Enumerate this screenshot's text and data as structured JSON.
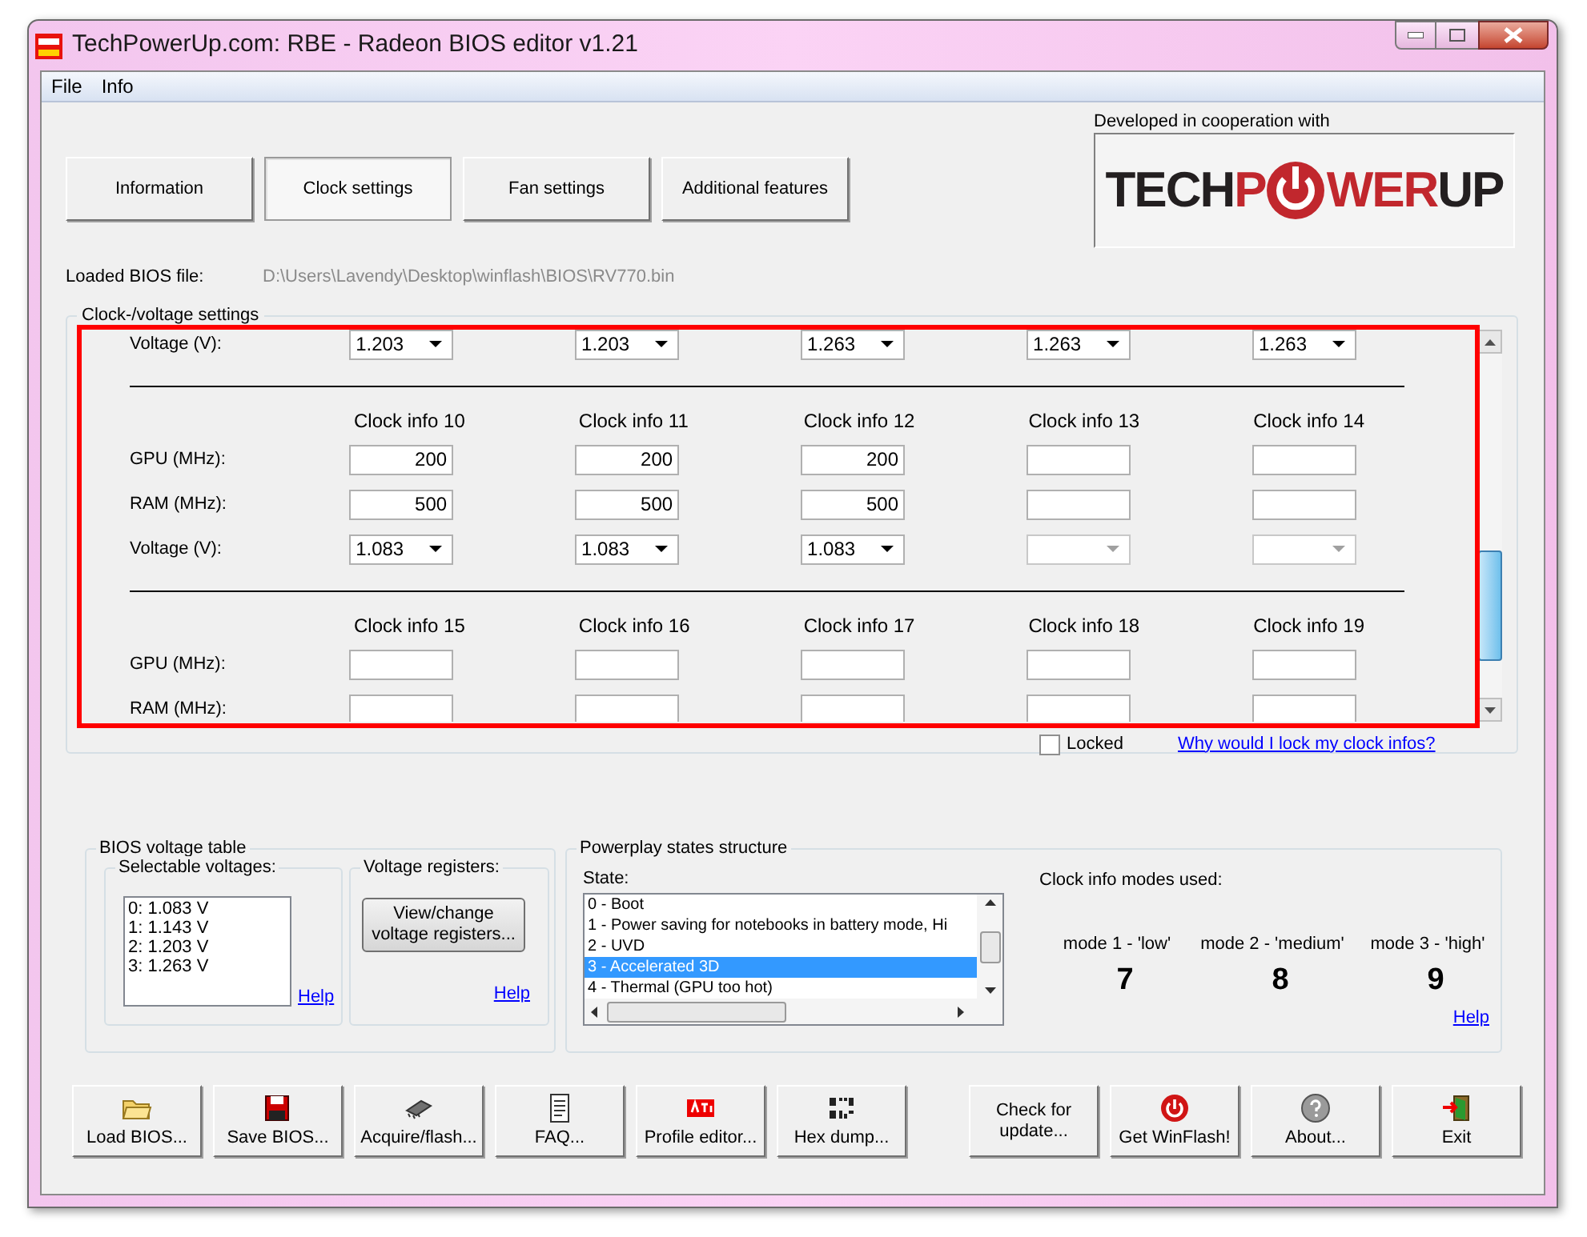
{
  "window": {
    "title": "TechPowerUp.com: RBE - Radeon BIOS editor v1.21"
  },
  "menu": [
    "File",
    "Info"
  ],
  "tabs": [
    {
      "label": "Information",
      "selected": false
    },
    {
      "label": "Clock settings",
      "selected": true
    },
    {
      "label": "Fan settings",
      "selected": false
    },
    {
      "label": "Additional features",
      "selected": false
    }
  ],
  "cooperation": {
    "caption": "Developed in cooperation with",
    "logo": [
      {
        "kind": "text",
        "text": "TECH",
        "color": "#231f20"
      },
      {
        "kind": "text",
        "text": "P",
        "color": "#c1272d"
      },
      {
        "kind": "power",
        "color": "#c1272d"
      },
      {
        "kind": "text",
        "text": "WER",
        "color": "#c1272d"
      },
      {
        "kind": "text",
        "text": "UP",
        "color": "#231f20"
      }
    ]
  },
  "loaded_file": {
    "label": "Loaded BIOS file:",
    "path": "D:\\Users\\Lavendy\\Desktop\\winflash\\BIOS\\RV770.bin"
  },
  "clock_voltage": {
    "title": "Clock-/voltage settings",
    "sections": [
      {
        "rows": [
          {
            "label": "Voltage (V):",
            "kind": "dropdown",
            "cells": [
              {
                "value": "1.203",
                "disabled": false
              },
              {
                "value": "1.203",
                "disabled": false
              },
              {
                "value": "1.263",
                "disabled": false
              },
              {
                "value": "1.263",
                "disabled": false
              },
              {
                "value": "1.263",
                "disabled": false
              }
            ]
          }
        ]
      },
      {
        "headers": [
          "Clock info 10",
          "Clock info 11",
          "Clock info 12",
          "Clock info 13",
          "Clock info 14"
        ],
        "rows": [
          {
            "label": "GPU (MHz):",
            "kind": "text",
            "cells": [
              {
                "value": "200"
              },
              {
                "value": "200"
              },
              {
                "value": "200"
              },
              {},
              {}
            ]
          },
          {
            "label": "RAM (MHz):",
            "kind": "text",
            "cells": [
              {
                "value": "500"
              },
              {
                "value": "500"
              },
              {
                "value": "500"
              },
              {},
              {}
            ]
          },
          {
            "label": "Voltage (V):",
            "kind": "dropdown",
            "cells": [
              {
                "value": "1.083",
                "disabled": false
              },
              {
                "value": "1.083",
                "disabled": false
              },
              {
                "value": "1.083",
                "disabled": false
              },
              {
                "disabled": true
              },
              {
                "disabled": true
              }
            ]
          }
        ]
      },
      {
        "headers": [
          "Clock info 15",
          "Clock info 16",
          "Clock info 17",
          "Clock info 18",
          "Clock info 19"
        ],
        "rows": [
          {
            "label": "GPU (MHz):",
            "kind": "text",
            "cells": [
              {},
              {},
              {},
              {},
              {}
            ]
          },
          {
            "label": "RAM (MHz):",
            "kind": "text",
            "cells": [
              {},
              {},
              {},
              {},
              {}
            ]
          }
        ]
      }
    ],
    "locked": {
      "label": "Locked",
      "checked": false
    },
    "help_link": "Why would I lock my clock infos?"
  },
  "voltage_table": {
    "title": "BIOS voltage table",
    "selectable": {
      "title": "Selectable voltages:",
      "items": [
        "0: 1.083 V",
        "1: 1.143 V",
        "2: 1.203 V",
        "3: 1.263 V"
      ],
      "help": "Help"
    },
    "registers": {
      "title": "Voltage registers:",
      "button": "View/change voltage registers...",
      "help": "Help"
    }
  },
  "powerplay": {
    "title": "Powerplay states structure",
    "state_label": "State:",
    "states": [
      {
        "label": "0 - Boot",
        "selected": false
      },
      {
        "label": "1 - Power saving for notebooks in battery mode, Hi",
        "selected": false
      },
      {
        "label": "2 - UVD",
        "selected": false
      },
      {
        "label": "3 - Accelerated 3D",
        "selected": true
      },
      {
        "label": "4 - Thermal (GPU too hot)",
        "selected": false
      }
    ],
    "modes_title": "Clock info modes used:",
    "modes": [
      {
        "label": "mode 1 - 'low'",
        "value": "7"
      },
      {
        "label": "mode 2 - 'medium'",
        "value": "8"
      },
      {
        "label": "mode 3 - 'high'",
        "value": "9"
      }
    ],
    "help": "Help"
  },
  "buttons": [
    {
      "label": "Load BIOS...",
      "kind": "folder"
    },
    {
      "label": "Save BIOS...",
      "kind": "floppy"
    },
    {
      "label": "Acquire/flash...",
      "kind": "chip"
    },
    {
      "label": "FAQ...",
      "kind": "document"
    },
    {
      "label": "Profile editor...",
      "kind": "ati"
    },
    {
      "label": "Hex dump...",
      "kind": "hex"
    },
    {
      "label": "Check for update...",
      "kind": "none"
    },
    {
      "label": "Get WinFlash!",
      "kind": "power"
    },
    {
      "label": "About...",
      "kind": "question"
    },
    {
      "label": "Exit",
      "kind": "exit"
    }
  ]
}
